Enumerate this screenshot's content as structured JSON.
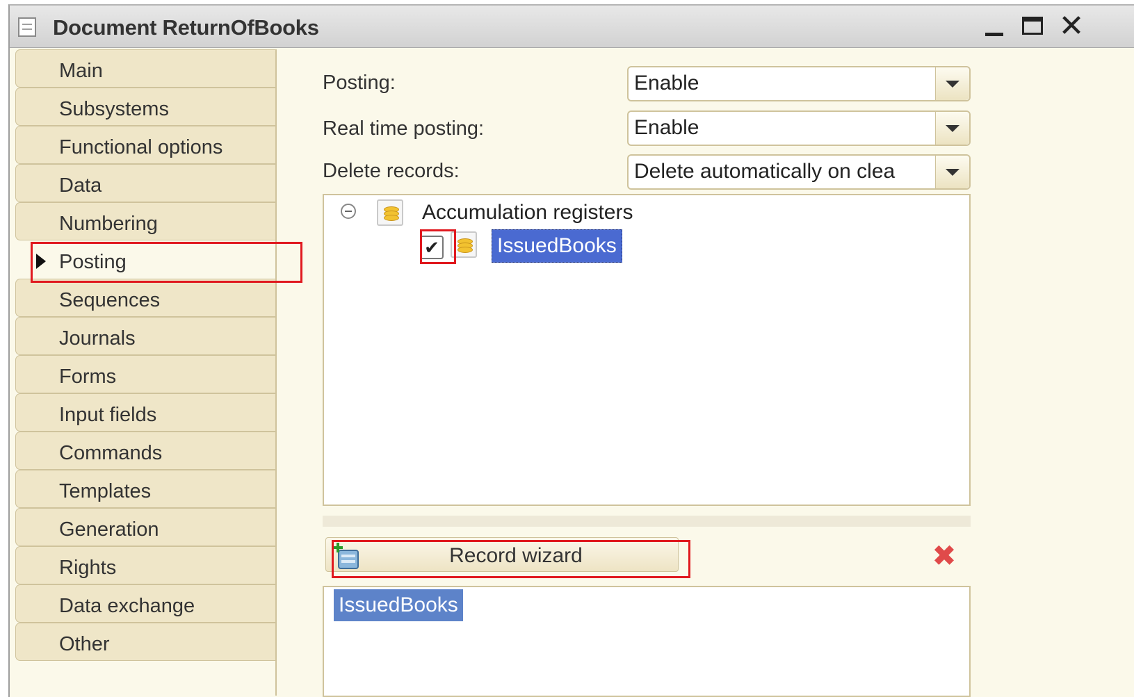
{
  "window": {
    "title": "Document ReturnOfBooks",
    "controls": {
      "minimize": "_",
      "maximize": "☐",
      "close": "✕"
    }
  },
  "sidebar": {
    "items": [
      {
        "label": "Main"
      },
      {
        "label": "Subsystems"
      },
      {
        "label": "Functional options"
      },
      {
        "label": "Data"
      },
      {
        "label": "Numbering"
      },
      {
        "label": "Posting",
        "active": true
      },
      {
        "label": "Sequences"
      },
      {
        "label": "Journals"
      },
      {
        "label": "Forms"
      },
      {
        "label": "Input fields"
      },
      {
        "label": "Commands"
      },
      {
        "label": "Templates"
      },
      {
        "label": "Generation"
      },
      {
        "label": "Rights"
      },
      {
        "label": "Data exchange"
      },
      {
        "label": "Other"
      }
    ]
  },
  "form": {
    "posting": {
      "label": "Posting:",
      "value": "Enable"
    },
    "real_time_posting": {
      "label": "Real time posting:",
      "value": "Enable"
    },
    "delete_records": {
      "label": "Delete records:",
      "value": "Delete automatically on clea"
    }
  },
  "tree": {
    "root": {
      "label": "Accumulation registers",
      "icon": "accumulation-register-icon",
      "expanded": true
    },
    "children": [
      {
        "label": "IssuedBooks",
        "checked": true,
        "selected": true,
        "icon": "accumulation-register-icon"
      }
    ]
  },
  "actions": {
    "record_wizard": {
      "label": "Record wizard",
      "icon": "record-wizard-icon"
    },
    "delete": {
      "icon": "delete-icon",
      "symbol": "✖"
    }
  },
  "results": {
    "items": [
      {
        "label": "IssuedBooks"
      }
    ]
  },
  "colors": {
    "highlight": "#e0191f",
    "selection": "#4a6ad1",
    "tab_bg": "#efe6c8",
    "panel_bg": "#fbf9ea"
  }
}
